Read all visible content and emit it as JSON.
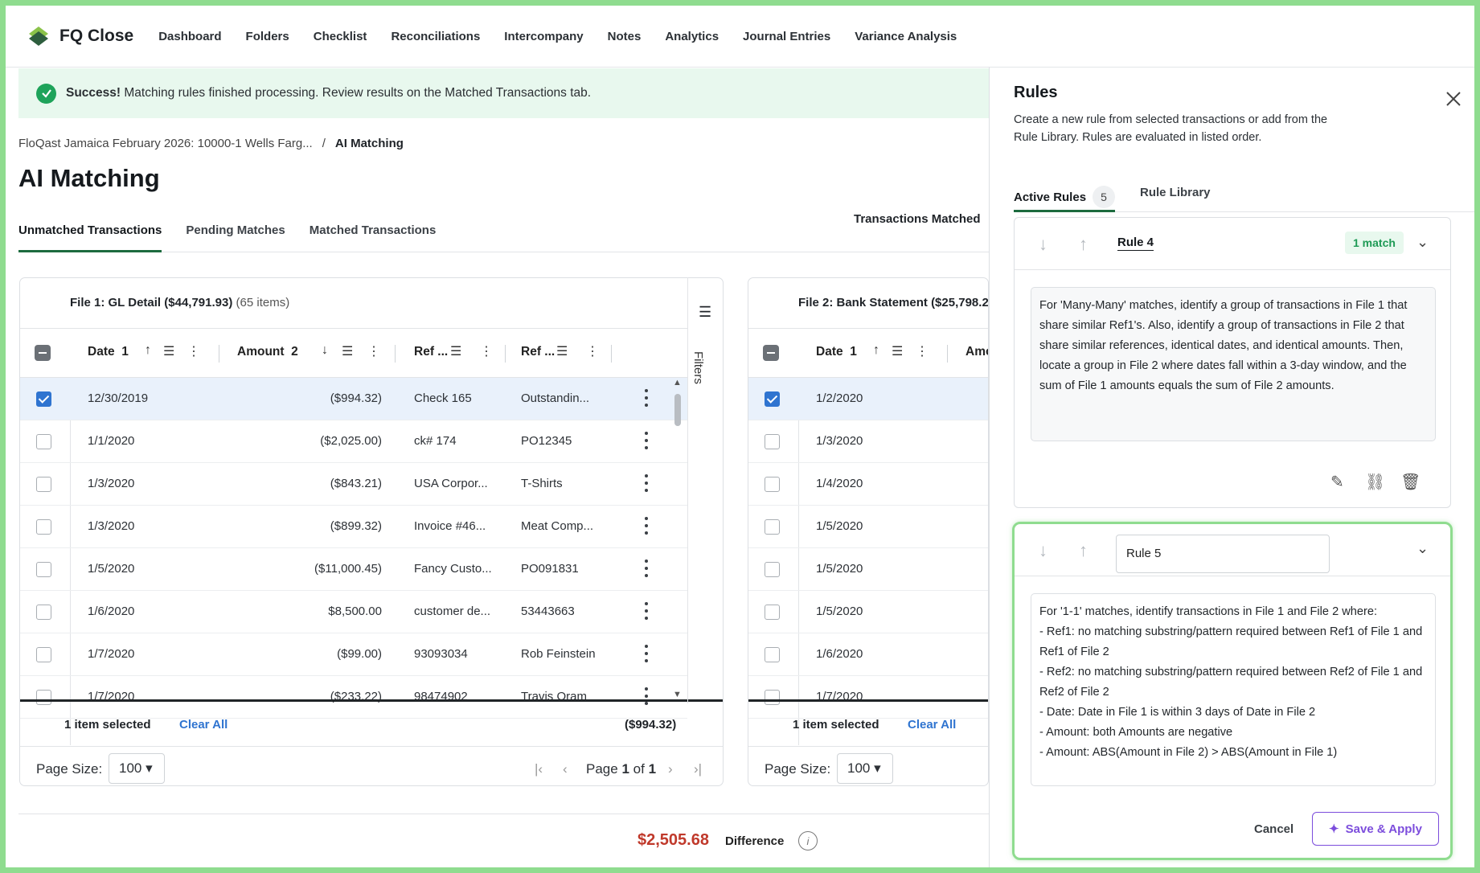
{
  "app": {
    "name": "FQ Close"
  },
  "nav": [
    "Dashboard",
    "Folders",
    "Checklist",
    "Reconciliations",
    "Intercompany",
    "Notes",
    "Analytics",
    "Journal Entries",
    "Variance Analysis"
  ],
  "banner": {
    "bold": "Success!",
    "text": "Matching rules finished processing. Review results on the Matched Transactions tab."
  },
  "breadcrumb": {
    "parent": "FloQast Jamaica February 2026: 10000-1 Wells Farg...",
    "sep": "/",
    "current": "AI Matching"
  },
  "page_title": "AI Matching",
  "tabs": [
    "Unmatched Transactions",
    "Pending Matches",
    "Matched Transactions"
  ],
  "transactions_matched_label": "Transactions Matched",
  "file1": {
    "title": "File 1: GL Detail",
    "total": "($44,791.93)",
    "count": "(65 items)",
    "columns": {
      "date": "Date",
      "date_sort": "1",
      "amount": "Amount",
      "amount_sort": "2",
      "ref1": "Ref ...",
      "ref2": "Ref ..."
    },
    "filters_label": "Filters",
    "rows": [
      {
        "date": "12/30/2019",
        "amount": "($994.32)",
        "ref1": "Check 165",
        "ref2": "Outstandin...",
        "selected": true
      },
      {
        "date": "1/1/2020",
        "amount": "($2,025.00)",
        "ref1": "ck# 174",
        "ref2": "PO12345",
        "selected": false
      },
      {
        "date": "1/3/2020",
        "amount": "($843.21)",
        "ref1": "USA Corpor...",
        "ref2": "T-Shirts",
        "selected": false
      },
      {
        "date": "1/3/2020",
        "amount": "($899.32)",
        "ref1": "Invoice #46...",
        "ref2": "Meat Comp...",
        "selected": false
      },
      {
        "date": "1/5/2020",
        "amount": "($11,000.45)",
        "ref1": "Fancy Custo...",
        "ref2": "PO091831",
        "selected": false
      },
      {
        "date": "1/6/2020",
        "amount": "$8,500.00",
        "ref1": "customer de...",
        "ref2": "53443663",
        "selected": false
      },
      {
        "date": "1/7/2020",
        "amount": "($99.00)",
        "ref1": "93093034",
        "ref2": "Rob Feinstein",
        "selected": false
      },
      {
        "date": "1/7/2020",
        "amount": "($233.22)",
        "ref1": "98474902",
        "ref2": "Travis Oram",
        "selected": false
      }
    ],
    "selected_label": "1 item selected",
    "clear_all": "Clear All",
    "selected_total": "($994.32)",
    "page_size_label": "Page Size:",
    "page_size": "100",
    "page_label": "Page",
    "page_current": "1",
    "page_of": "of",
    "page_total": "1"
  },
  "file2": {
    "title": "File 2: Bank Statement",
    "total": "($25,798.2",
    "columns": {
      "date": "Date",
      "date_sort": "1",
      "amount": "Amo"
    },
    "rows": [
      {
        "date": "1/2/2020",
        "selected": true
      },
      {
        "date": "1/3/2020",
        "selected": false
      },
      {
        "date": "1/4/2020",
        "selected": false
      },
      {
        "date": "1/5/2020",
        "selected": false
      },
      {
        "date": "1/5/2020",
        "selected": false
      },
      {
        "date": "1/5/2020",
        "selected": false
      },
      {
        "date": "1/6/2020",
        "selected": false
      },
      {
        "date": "1/7/2020",
        "selected": false
      }
    ],
    "selected_label": "1 item selected",
    "clear_all": "Clear All",
    "page_size_label": "Page Size:",
    "page_size": "100"
  },
  "difference": {
    "value": "$2,505.68",
    "label": "Difference"
  },
  "rules": {
    "title": "Rules",
    "description": "Create a new rule from selected transactions or add from the Rule Library. Rules are evaluated in listed order.",
    "tab_active": "Active Rules",
    "active_count": "5",
    "tab_library": "Rule Library",
    "rule4": {
      "name": "Rule 4",
      "badge": "1 match",
      "text": "For 'Many-Many' matches, identify a group of transactions in File 1 that share similar Ref1's. Also, identify a group of transactions in File 2 that share similar references, identical dates, and identical amounts. Then, locate a group in File 2 where dates fall within a 3-day window, and the sum of File 1 amounts equals the sum of File 2 amounts."
    },
    "rule5": {
      "name": "Rule 5",
      "lines": [
        "For '1-1' matches, identify transactions in File 1 and File 2 where:",
        "- Ref1: no matching substring/pattern required between Ref1 of File 1 and Ref1 of File 2",
        "- Ref2: no matching substring/pattern required between Ref2 of File 1 and Ref2 of File 2",
        "- Date: Date in File 1 is within 3 days of Date in File 2",
        "- Amount: both Amounts are negative",
        "- Amount: ABS(Amount in File 2) > ABS(Amount in File 1)"
      ],
      "cancel": "Cancel",
      "save_apply": "Save & Apply"
    }
  },
  "colors": {
    "accent_green": "#1d6b3f",
    "success_bg": "#e8f8ee",
    "link_blue": "#2f74d0",
    "diff_red": "#c0392b",
    "highlight_green": "#8fdc8f",
    "save_purple": "#7c4ddc"
  },
  "icons": [
    "logo-icon",
    "check-circle-icon",
    "sort-up-icon",
    "sort-down-icon",
    "filter-icon",
    "kebab-icon",
    "close-icon",
    "chevron-down-icon",
    "arrow-down-icon",
    "arrow-up-icon",
    "pencil-icon",
    "unlink-icon",
    "trash-icon",
    "sparkle-icon",
    "info-icon",
    "first-page-icon",
    "prev-page-icon",
    "next-page-icon",
    "last-page-icon"
  ]
}
